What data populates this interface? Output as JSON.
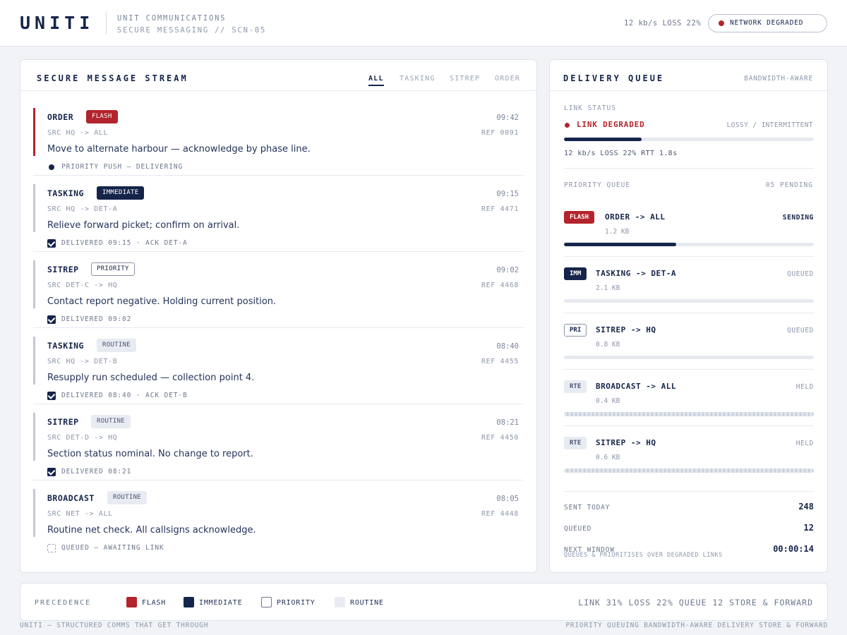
{
  "app": {
    "logo": "UNITI",
    "subtitle1": "UNIT COMMUNICATIONS",
    "subtitle2": "SECURE MESSAGING // SCN-05",
    "rate": "12 kb/s LOSS 22%",
    "network_status": "NETWORK DEGRADED"
  },
  "stream": {
    "title": "SECURE MESSAGE STREAM",
    "tabs": [
      "ALL",
      "TASKING",
      "SITREP",
      "ORDER"
    ],
    "active_tab": "ALL",
    "messages": [
      {
        "type": "ORDER",
        "tag": "FLASH",
        "level": "flash",
        "time": "09:42",
        "src": "SRC HQ -> ALL",
        "ref": "REF 0091",
        "body": "Move to alternate harbour — acknowledge by phase line.",
        "status_icon": "dot",
        "status": "PRIORITY PUSH — DELIVERING"
      },
      {
        "type": "TASKING",
        "tag": "IMMEDIATE",
        "level": "imm",
        "time": "09:15",
        "src": "SRC HQ -> DET-A",
        "ref": "REF 4471",
        "body": "Relieve forward picket; confirm on arrival.",
        "status_icon": "check",
        "status": "DELIVERED 09:15 · ACK DET-A"
      },
      {
        "type": "SITREP",
        "tag": "PRIORITY",
        "level": "pri",
        "time": "09:02",
        "src": "SRC DET-C -> HQ",
        "ref": "REF 4468",
        "body": "Contact report negative. Holding current position.",
        "status_icon": "check",
        "status": "DELIVERED 09:02"
      },
      {
        "type": "TASKING",
        "tag": "ROUTINE",
        "level": "rte",
        "time": "08:40",
        "src": "SRC HQ -> DET-B",
        "ref": "REF 4455",
        "body": "Resupply run scheduled — collection point 4.",
        "status_icon": "check",
        "status": "DELIVERED 08:40 · ACK DET-B"
      },
      {
        "type": "SITREP",
        "tag": "ROUTINE",
        "level": "rte",
        "time": "08:21",
        "src": "SRC DET-D -> HQ",
        "ref": "REF 4450",
        "body": "Section status nominal. No change to report.",
        "status_icon": "check",
        "status": "DELIVERED 08:21"
      },
      {
        "type": "BROADCAST",
        "tag": "ROUTINE",
        "level": "rte",
        "time": "08:05",
        "src": "SRC NET -> ALL",
        "ref": "REF 4448",
        "body": "Routine net check. All callsigns acknowledge.",
        "status_icon": "pending",
        "status": "QUEUED — AWAITING LINK"
      }
    ]
  },
  "queue": {
    "title": "DELIVERY QUEUE",
    "mode": "BANDWIDTH-AWARE",
    "link_label": "LINK STATUS",
    "link_state": "LINK DEGRADED",
    "link_desc": "LOSSY / INTERMITTENT",
    "link_quality": 0.31,
    "link_stats": "12 kb/s LOSS 22% RTT 1.8s",
    "pq_label": "PRIORITY QUEUE",
    "pq_pending": "05 PENDING",
    "items": [
      {
        "tag": "FLASH",
        "level": "flash",
        "name": "ORDER -> ALL",
        "size": "1.2 KB",
        "state": "SENDING",
        "progress": 0.45,
        "held": false
      },
      {
        "tag": "IMM",
        "level": "imm",
        "name": "TASKING -> DET-A",
        "size": "2.1 KB",
        "state": "QUEUED",
        "progress": 0,
        "held": false
      },
      {
        "tag": "PRI",
        "level": "pri",
        "name": "SITREP -> HQ",
        "size": "0.8 KB",
        "state": "QUEUED",
        "progress": 0,
        "held": false
      },
      {
        "tag": "RTE",
        "level": "rte",
        "name": "BROADCAST -> ALL",
        "size": "0.4 KB",
        "state": "HELD",
        "progress": 0,
        "held": true
      },
      {
        "tag": "RTE",
        "level": "rte",
        "name": "SITREP -> HQ",
        "size": "0.6 KB",
        "state": "HELD",
        "progress": 0,
        "held": true
      }
    ],
    "stats": [
      {
        "label": "SENT TODAY",
        "value": "248"
      },
      {
        "label": "QUEUED",
        "value": "12"
      },
      {
        "label": "NEXT WINDOW",
        "value": "00:00:14"
      }
    ],
    "note": "QUEUES & PRIORITISES OVER DEGRADED LINKS"
  },
  "legend": {
    "title": "PRECEDENCE",
    "items": [
      {
        "level": "flash",
        "label": "FLASH"
      },
      {
        "level": "imm",
        "label": "IMMEDIATE"
      },
      {
        "level": "pri",
        "label": "PRIORITY"
      },
      {
        "level": "rte",
        "label": "ROUTINE"
      }
    ],
    "summary": "LINK 31% LOSS 22% QUEUE 12 STORE & FORWARD"
  },
  "footer": {
    "left": "UNITI — STRUCTURED COMMS THAT GET THROUGH",
    "right": "PRIORITY QUEUING BANDWIDTH-AWARE DELIVERY STORE & FORWARD"
  },
  "colors": {
    "flash": "#b3242c",
    "immediate": "#15244a",
    "routine": "#e8ebf2"
  }
}
